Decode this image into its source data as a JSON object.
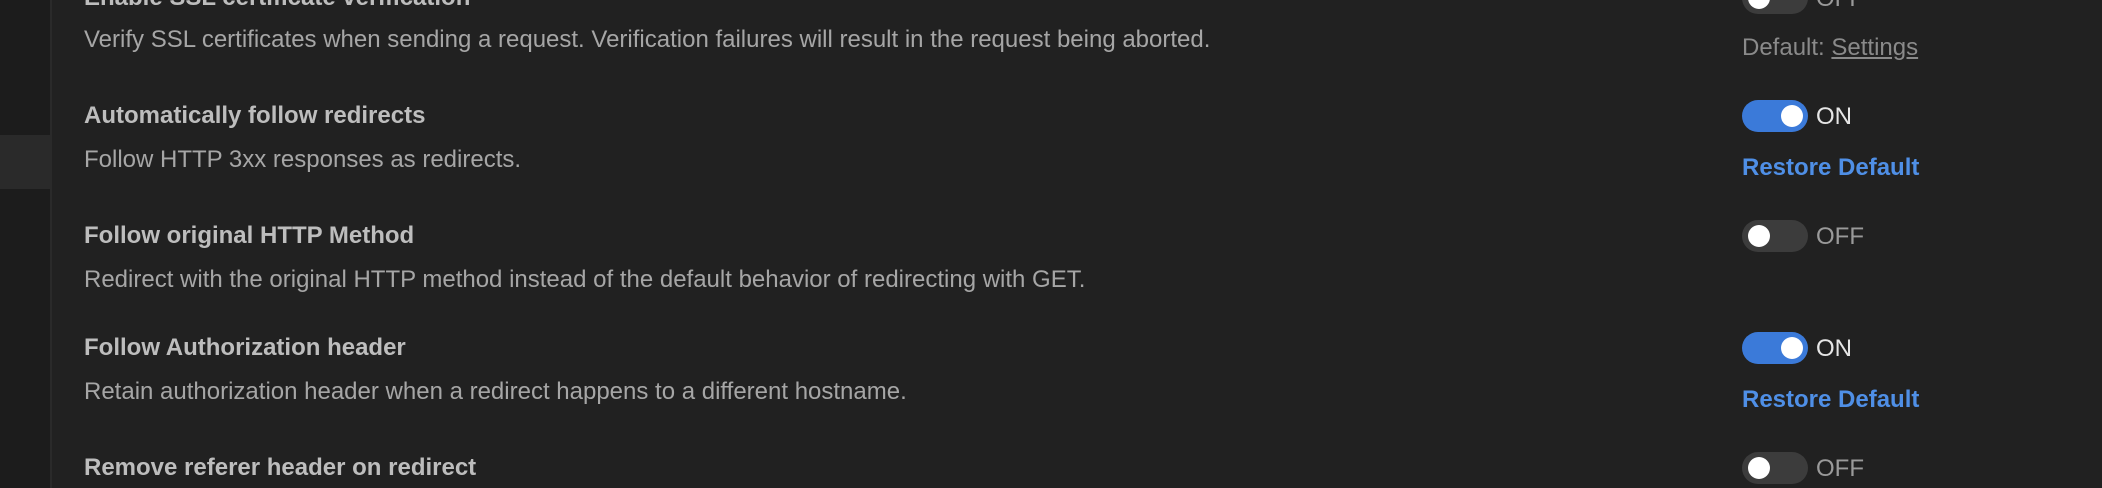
{
  "settings": [
    {
      "title": "Enable SSL certificate verification",
      "description": "Verify SSL certificates when sending a request. Verification failures will result in the request being aborted.",
      "state": "OFF",
      "default_prefix": "Default: ",
      "default_link": "Settings"
    },
    {
      "title": "Automatically follow redirects",
      "description": "Follow HTTP 3xx responses as redirects.",
      "state": "ON",
      "restore": "Restore Default"
    },
    {
      "title": "Follow original HTTP Method",
      "description": "Redirect with the original HTTP method instead of the default behavior of redirecting with GET.",
      "state": "OFF"
    },
    {
      "title": "Follow Authorization header",
      "description": "Retain authorization header when a redirect happens to a different hostname.",
      "state": "ON",
      "restore": "Restore Default"
    },
    {
      "title": "Remove referer header on redirect",
      "state": "OFF"
    }
  ],
  "colors": {
    "background": "#212121",
    "toggle_on": "#3b7ad9",
    "toggle_off": "#3c3c3c",
    "link_blue": "#4f8fe6"
  }
}
